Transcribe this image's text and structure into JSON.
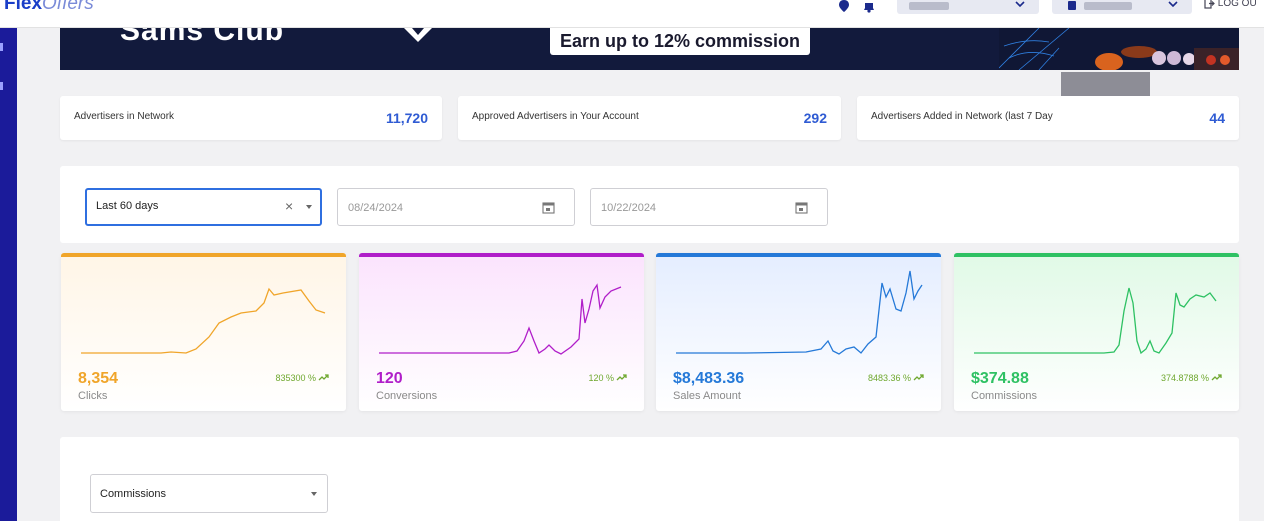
{
  "header": {
    "logo_bold": "Flex",
    "logo_light": "Offers",
    "logout_label": "LOG OU"
  },
  "banner": {
    "brand_text": "Sams Club",
    "promo_text": "Earn up to 12% commission"
  },
  "stats": [
    {
      "label": "Advertisers in Network",
      "value": "11,720"
    },
    {
      "label": "Approved Advertisers in Your Account",
      "value": "292"
    },
    {
      "label": "Advertisers Added in Network (last 7 Day",
      "value": "44"
    }
  ],
  "filters": {
    "range_value": "Last 60 days",
    "start_date": "08/24/2024",
    "end_date": "10/22/2024"
  },
  "cards": [
    {
      "value": "8,354",
      "label": "Clicks",
      "change": "835300 %",
      "color": "#f0a52a",
      "bg_from": "#fff7ea",
      "bg_to": "#ffffff"
    },
    {
      "value": "120",
      "label": "Conversions",
      "change": "120 %",
      "color": "#b01ec9",
      "bg_from": "#fde9fe",
      "bg_to": "#ffffff"
    },
    {
      "value": "$8,483.36",
      "label": "Sales Amount",
      "change": "8483.36 %",
      "color": "#2579d8",
      "bg_from": "#e6efff",
      "bg_to": "#ffffff"
    },
    {
      "value": "$374.88",
      "label": "Commissions",
      "change": "374.8788 %",
      "color": "#2ec163",
      "bg_from": "#e4fbe9",
      "bg_to": "#ffffff"
    }
  ],
  "bottom": {
    "metric_select_value": "Commissions"
  },
  "colors": {
    "accent": "#2f5bd3",
    "sidebar": "#1b1b9a",
    "positive_change": "#6fa82f"
  }
}
